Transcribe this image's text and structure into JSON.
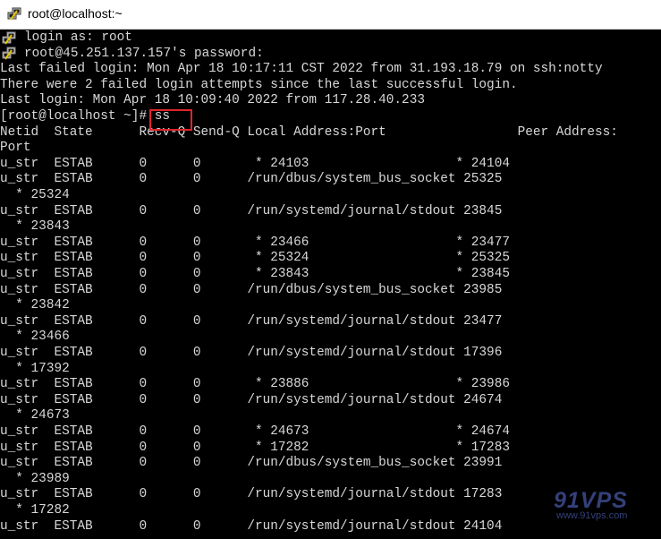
{
  "window": {
    "title": "root@localhost:~",
    "icon": "putty-terminal-icon"
  },
  "terminal": {
    "login_prompt": "login as: root",
    "password_prompt": "root@45.251.137.157's password:",
    "failed_login": "Last failed login: Mon Apr 18 10:17:11 CST 2022 from 31.193.18.79 on ssh:notty",
    "failed_attempts": "There were 2 failed login attempts since the last successful login.",
    "last_login": "Last login: Mon Apr 18 10:09:40 2022 from 117.28.40.233",
    "prompt": "[root@localhost ~]# ",
    "command": "ss",
    "header": "Netid  State      Recv-Q Send-Q Local Address:Port                 Peer Address:",
    "header_wrap": "Port",
    "rows": [
      "u_str  ESTAB      0      0       * 24103                   * 24104",
      "u_str  ESTAB      0      0      /run/dbus/system_bus_socket 25325",
      "  * 25324",
      "u_str  ESTAB      0      0      /run/systemd/journal/stdout 23845",
      "  * 23843",
      "u_str  ESTAB      0      0       * 23466                   * 23477",
      "u_str  ESTAB      0      0       * 25324                   * 25325",
      "u_str  ESTAB      0      0       * 23843                   * 23845",
      "u_str  ESTAB      0      0      /run/dbus/system_bus_socket 23985",
      "  * 23842",
      "u_str  ESTAB      0      0      /run/systemd/journal/stdout 23477",
      "  * 23466",
      "u_str  ESTAB      0      0      /run/systemd/journal/stdout 17396",
      "  * 17392",
      "u_str  ESTAB      0      0       * 23886                   * 23986",
      "u_str  ESTAB      0      0      /run/systemd/journal/stdout 24674",
      "  * 24673",
      "u_str  ESTAB      0      0       * 24673                   * 24674",
      "u_str  ESTAB      0      0       * 17282                   * 17283",
      "u_str  ESTAB      0      0      /run/dbus/system_bus_socket 23991",
      "  * 23989",
      "u_str  ESTAB      0      0      /run/systemd/journal/stdout 17283",
      "  * 17282",
      "u_str  ESTAB      0      0      /run/systemd/journal/stdout 24104"
    ],
    "text_color": "#d8d8d8",
    "background": "#000000",
    "highlight_color": "#e0242a"
  },
  "watermark": {
    "logo": "91VPS",
    "url": "www.91vps.com",
    "color": "#34407a"
  }
}
